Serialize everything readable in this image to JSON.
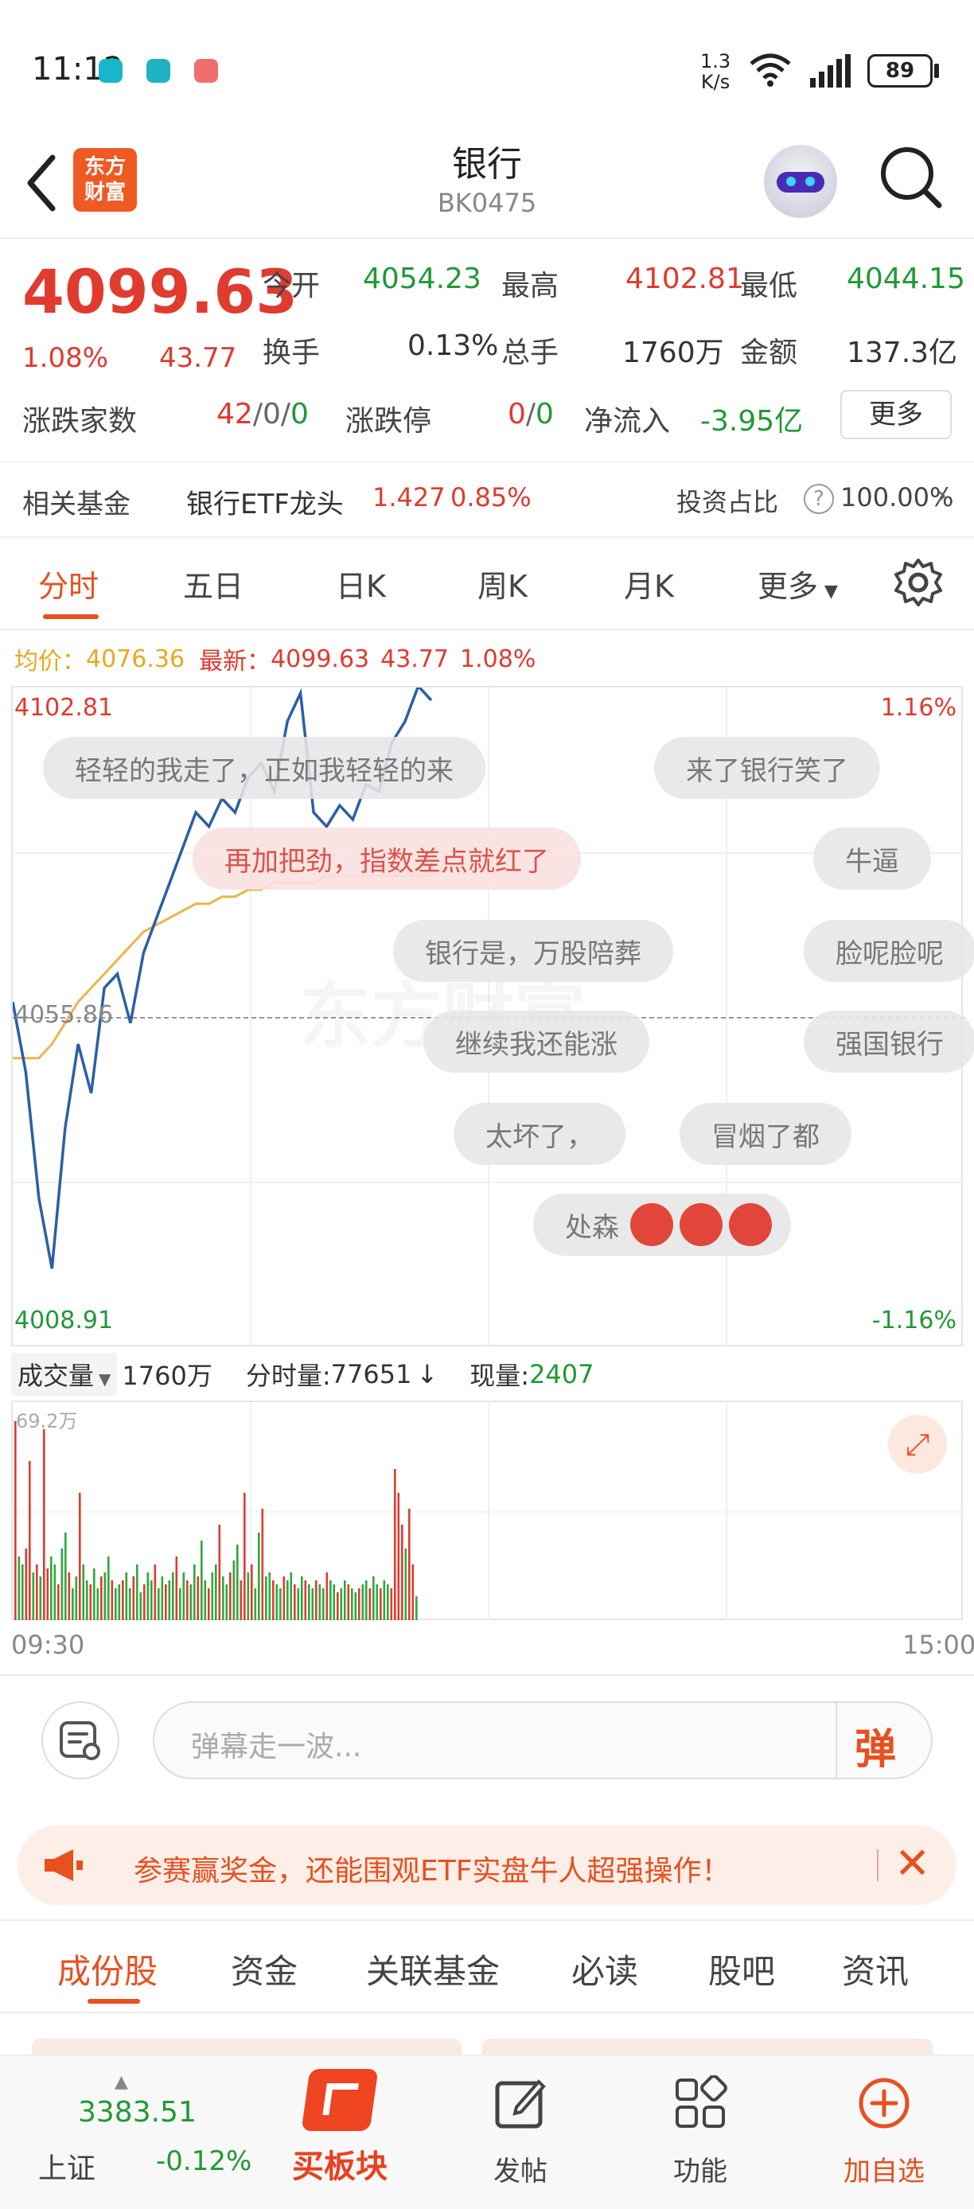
{
  "status_bar": {
    "time": "11:12",
    "net_speed_top": "1.3",
    "net_speed_bottom": "K/s",
    "battery": "89"
  },
  "header": {
    "title": "银行",
    "code": "BK0475",
    "logo_line1": "东方",
    "logo_line2": "财富"
  },
  "quote": {
    "price": "4099.63",
    "pct": "1.08%",
    "change": "43.77",
    "open_label": "今开",
    "open": "4054.23",
    "high_label": "最高",
    "high": "4102.81",
    "low_label": "最低",
    "low": "4044.15",
    "turnover_label": "换手",
    "turnover": "0.13%",
    "volume_label": "总手",
    "volume": "1760万",
    "amount_label": "金额",
    "amount": "137.3亿",
    "updown_label": "涨跌家数",
    "updown_up": "42",
    "updown_flat": "0",
    "updown_down": "0",
    "limit_label": "涨跌停",
    "limit_up": "0",
    "limit_down": "0",
    "netflow_label": "净流入",
    "netflow": "-3.95亿",
    "more_btn": "更多"
  },
  "fund_row": {
    "label": "相关基金",
    "fund_name": "银行ETF龙头",
    "fund_price": "1.427",
    "fund_pct": "0.85%",
    "ratio_label": "投资占比",
    "ratio_value": "100.00%"
  },
  "chart_tabs": {
    "items": [
      "分时",
      "五日",
      "日K",
      "周K",
      "月K"
    ],
    "more": "更多"
  },
  "avg_line": {
    "avg_label": "均价：",
    "avg_value": "4076.36",
    "latest_label": "最新：",
    "latest_value": "4099.63",
    "latest_change": "43.77",
    "latest_pct": "1.08%"
  },
  "intraday": {
    "y_top": "4102.81",
    "y_mid": "4055.86",
    "y_bottom": "4008.91",
    "pct_top": "1.16%",
    "pct_bottom": "-1.16%",
    "watermark": "东方财富"
  },
  "danmaku": [
    {
      "text": "轻轻的我走了，正如我轻轻的来"
    },
    {
      "text": "来了银行笑了"
    },
    {
      "text": "再加把劲，指数差点就红了"
    },
    {
      "text": "牛逼"
    },
    {
      "text": "银行是，万股陪葬"
    },
    {
      "text": "脸呢脸呢"
    },
    {
      "text": "继续我还能涨"
    },
    {
      "text": "强国银行"
    },
    {
      "text": "太坏了，"
    },
    {
      "text": "冒烟了都"
    },
    {
      "text": "处森"
    }
  ],
  "volume_bar": {
    "label": "成交量",
    "total": "1760万",
    "minute_label": "分时量:",
    "minute_value": "77651",
    "current_label": "现量:",
    "current_value": "2407",
    "max_label": "69.2万",
    "time_start": "09:30",
    "time_end": "15:00"
  },
  "comment": {
    "placeholder": "弹幕走一波...",
    "send": "弹"
  },
  "banner": {
    "text": "参赛赢奖金，还能围观ETF实盘牛人超强操作！"
  },
  "bottom_tabs": {
    "items": [
      "成份股",
      "资金",
      "关联基金",
      "必读",
      "股吧",
      "资讯"
    ]
  },
  "nav": {
    "index_value": "3383.51",
    "index_name": "上证",
    "index_pct": "-0.12%",
    "buy_block": "买板块",
    "post": "发帖",
    "func": "功能",
    "add": "加自选"
  },
  "chart_data": {
    "type": "line",
    "series": [
      {
        "values": [
          4058,
          4048,
          4030,
          4020,
          4040,
          4052,
          4045,
          4060,
          4062,
          4055,
          4065,
          4070,
          4075,
          4080,
          4085,
          4083,
          4087,
          4085,
          4090,
          4092,
          4088,
          4098,
          4102,
          4085,
          4083,
          4086,
          4084,
          4089,
          4088,
          4095,
          4098,
          4103,
          4101
        ]
      },
      {
        "values": [
          4050,
          4050,
          4050,
          4052,
          4055,
          4058,
          4060,
          4062,
          4064,
          4066,
          4068,
          4069,
          4070,
          4071,
          4072,
          4072,
          4073,
          4073,
          4074,
          4074,
          4075,
          4075,
          4075,
          4075,
          4076,
          4076,
          4076,
          4076,
          4076,
          4076,
          4076,
          4076,
          4076
        ]
      }
    ],
    "ylim": [
      4008.91,
      4102.81
    ]
  }
}
